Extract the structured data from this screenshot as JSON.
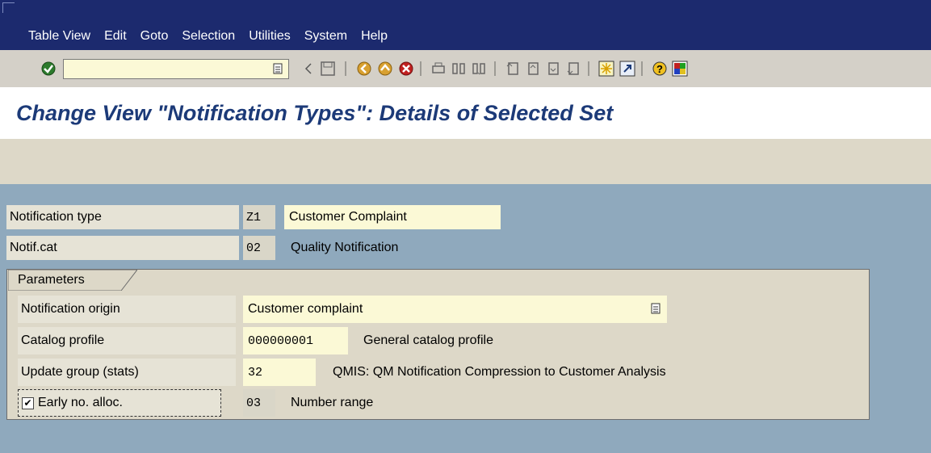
{
  "menu": [
    "Table View",
    "Edit",
    "Goto",
    "Selection",
    "Utilities",
    "System",
    "Help"
  ],
  "toolbar": {
    "icons": [
      "enter-icon",
      "command-dropdown-icon",
      "back-triangle-icon",
      "save-icon",
      "back-icon",
      "exit-icon",
      "cancel-icon",
      "print-icon",
      "find-icon",
      "find-next-icon",
      "first-page-icon",
      "previous-page-icon",
      "next-page-icon",
      "last-page-icon",
      "create-session-icon",
      "shortcut-icon",
      "help-icon",
      "customize-layout-icon"
    ],
    "command_value": ""
  },
  "page": {
    "title": "Change View \"Notification Types\": Details of Selected Set"
  },
  "fields": {
    "notification_type": {
      "label": "Notification type",
      "code": "Z1",
      "description": "Customer Complaint"
    },
    "notif_cat": {
      "label": "Notif.cat",
      "code": "02",
      "description": "Quality Notification"
    }
  },
  "parameters": {
    "tab_label": "Parameters",
    "notification_origin": {
      "label": "Notification origin",
      "value": "Customer complaint"
    },
    "catalog_profile": {
      "label": "Catalog profile",
      "value": "000000001",
      "description": "General catalog profile"
    },
    "update_group": {
      "label": "Update group (stats)",
      "value": "32",
      "description": "QMIS: QM Notification Compression to Customer Analysis"
    },
    "early_alloc": {
      "label": "Early no. alloc.",
      "checked": true,
      "value": "03",
      "description": "Number range"
    }
  },
  "colors": {
    "menubar": "#1c2a6e",
    "title": "#1c3a78",
    "content": "#8fa9bd",
    "panel": "#ddd8c8",
    "input": "#fbf9d6"
  }
}
